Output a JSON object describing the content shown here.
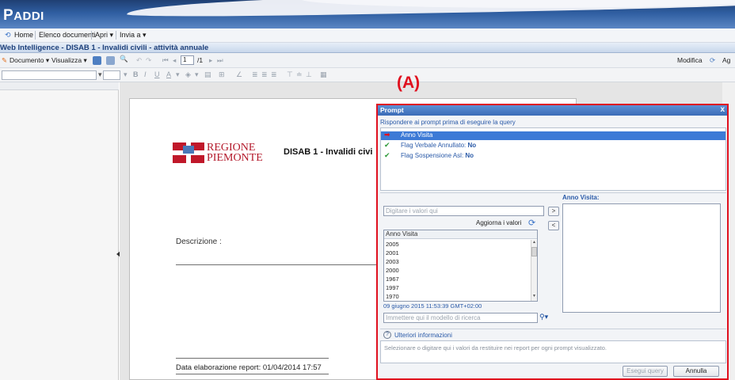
{
  "app": {
    "logo_initial": "P",
    "logo_rest": "ADDI"
  },
  "nav": {
    "home": "Home",
    "documents": "Elenco documenti",
    "open": "Apri ▾",
    "send": "Invia a ▾"
  },
  "window_title": "Web Intelligence - DISAB 1 - Invalidi civili - attività annuale",
  "toolbar1": {
    "document_menu": "Documento ▾",
    "view_menu": "Visualizza ▾",
    "page_input": "1",
    "page_total": "/1",
    "modify": "Modifica",
    "cut_label": "Ag"
  },
  "report": {
    "logo_line1": "REGIONE",
    "logo_line2": "PIEMONTE",
    "title": "DISAB 1 - Invalidi civi",
    "description_label": "Descrizione :",
    "elaboration_date": "Data elaborazione report:  01/04/2014 17:57"
  },
  "annotation": "(A)",
  "prompt_dialog": {
    "title": "Prompt",
    "close": "x",
    "instruction": "Rispondere ai prompt prima di eseguire la query",
    "prompts": [
      {
        "marker": "➡",
        "label": "Anno Visita",
        "value": "",
        "selected": true
      },
      {
        "marker": "✔",
        "label": "Flag Verbale Annullato:",
        "value": "No",
        "selected": false
      },
      {
        "marker": "✔",
        "label": "Flag Sospensione Asl:",
        "value": "No",
        "selected": false
      }
    ],
    "value_input_placeholder": "Digitare i valori qui",
    "refresh_label": "Aggiorna i valori",
    "add_button": ">",
    "remove_button": "<",
    "list_header": "Anno Visita",
    "list_values": [
      "2005",
      "2001",
      "2003",
      "2000",
      "1967",
      "1997",
      "1970"
    ],
    "refresh_date": "09 giugno 2015 11:53:39 GMT+02:00",
    "search_placeholder": "Immettere qui il modello di ricerca",
    "selected_label": "Anno Visita:",
    "info_label": "Ulteriori informazioni",
    "description_text": "Selezionare o digitare qui i valori da restituire nei report per ogni prompt visualizzato.",
    "run_button": "Esegui query",
    "cancel_button": "Annulla"
  },
  "colors": {
    "banner": "#2f5ea1",
    "accent": "#3d7ad6",
    "annotation_red": "#e0101e",
    "region_red": "#b3182a"
  }
}
